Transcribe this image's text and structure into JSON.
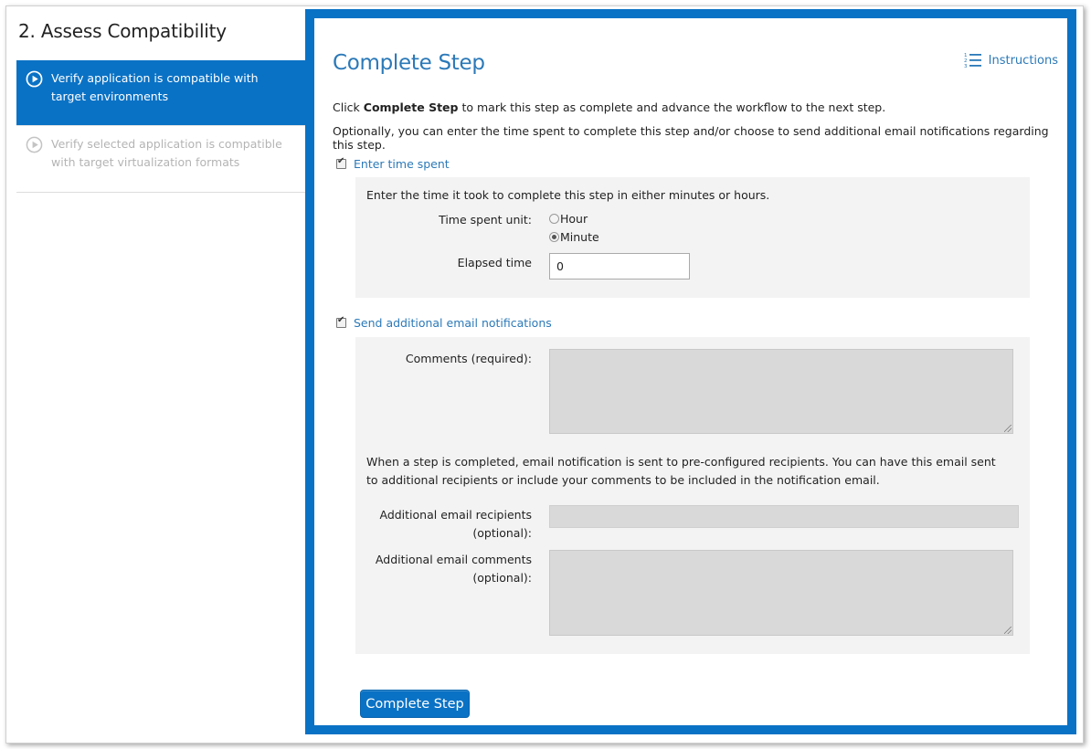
{
  "sidebar": {
    "title": "2. Assess Compatibility",
    "items": [
      {
        "label": "Verify application is compatible with target environments",
        "state": "active",
        "icon": "play-circle-icon"
      },
      {
        "label": "Verify selected application is compatible with target virtualization formats",
        "state": "inactive",
        "icon": "play-circle-icon"
      }
    ]
  },
  "main": {
    "title": "Complete Step",
    "instructions_label": "Instructions",
    "desc_prefix": "Click ",
    "desc_bold": "Complete Step",
    "desc_suffix": " to mark this step as complete and advance the workflow to the next step.",
    "desc2": "Optionally, you can enter the time spent to complete this step and/or choose to send additional email notifications regarding this step.",
    "time_section": {
      "checkbox_label": "Enter time spent",
      "checked": true,
      "hint": "Enter the time it took to complete this step in either minutes or hours.",
      "unit_label": "Time spent unit:",
      "unit_options": [
        "Hour",
        "Minute"
      ],
      "unit_selected": "Minute",
      "elapsed_label": "Elapsed time",
      "elapsed_value": "0"
    },
    "email_section": {
      "checkbox_label": "Send additional email notifications",
      "checked": true,
      "comments_label": "Comments (required):",
      "info_line1": "When a step is completed, email notification is sent to pre-configured recipients. You can have this email sent",
      "info_line2": "to additional recipients or include your comments to be included in the notification email.",
      "recipients_label_1": "Additional email recipients",
      "recipients_label_2": "(optional):",
      "extra_comments_label_1": "Additional email comments",
      "extra_comments_label_2": "(optional):"
    },
    "complete_button": "Complete Step"
  },
  "colors": {
    "accent": "#0a72c5",
    "link": "#2b79b8",
    "section_bg": "#f3f3f3",
    "disabled_input": "#d9d9d9"
  }
}
